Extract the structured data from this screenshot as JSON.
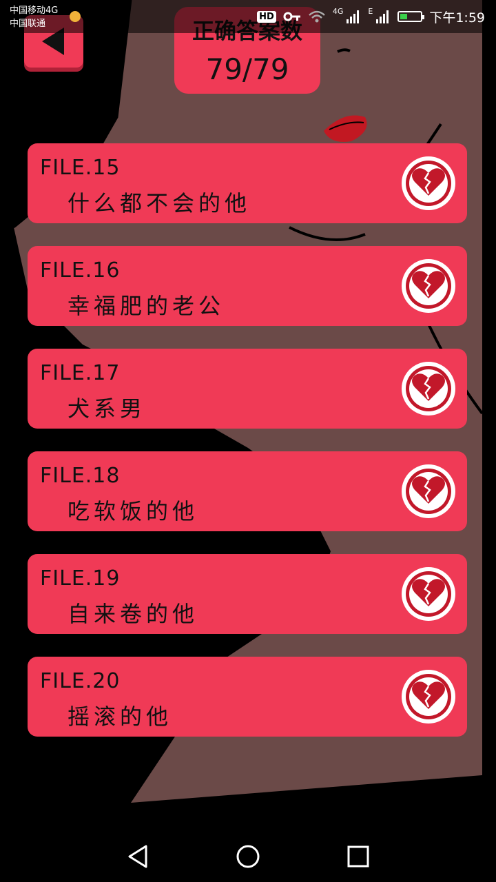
{
  "status_bar": {
    "carrier_1": "中国移动4G",
    "carrier_2": "中国联通",
    "hd_badge": "HD",
    "mobile_tag_1": "4G",
    "mobile_tag_2": "E",
    "time": "下午1:59",
    "battery_level": 0.35,
    "icons": [
      "key-icon",
      "wifi-icon",
      "signal-icon",
      "signal-icon",
      "battery-icon"
    ]
  },
  "header": {
    "back_icon": "triangle-left-icon",
    "score_label": "正确答案数",
    "score_value": "79/79"
  },
  "files": [
    {
      "number": "FILE.15",
      "title": "什么都不会的他",
      "icon": "broken-heart-icon"
    },
    {
      "number": "FILE.16",
      "title": "幸福肥的老公",
      "icon": "broken-heart-icon"
    },
    {
      "number": "FILE.17",
      "title": "犬系男",
      "icon": "broken-heart-icon"
    },
    {
      "number": "FILE.18",
      "title": "吃软饭的他",
      "icon": "broken-heart-icon"
    },
    {
      "number": "FILE.19",
      "title": "自来卷的他",
      "icon": "broken-heart-icon"
    },
    {
      "number": "FILE.20",
      "title": "摇滚的他",
      "icon": "broken-heart-icon"
    }
  ],
  "nav": {
    "icons": [
      "back-nav-icon",
      "home-nav-icon",
      "recents-nav-icon"
    ]
  },
  "colors": {
    "accent": "#f03a56",
    "background": "#000000",
    "illustration": "#6b4a48"
  }
}
